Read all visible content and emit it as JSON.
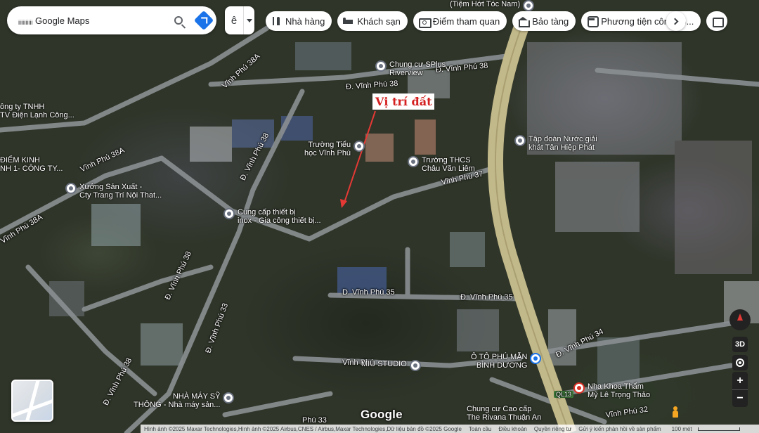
{
  "search": {
    "query": "ᵢᵢᵢᵢᵢᵢᵢᵢᵢᵢ Google Maps"
  },
  "hotel_toggle": {
    "glyph": "ê"
  },
  "chips": [
    {
      "label": "Nhà hàng",
      "icon": "fork-knife-icon"
    },
    {
      "label": "Khách sạn",
      "icon": "bed-icon"
    },
    {
      "label": "Điểm tham quan",
      "icon": "camera-icon"
    },
    {
      "label": "Bảo tàng",
      "icon": "museum-icon"
    },
    {
      "label": "Phương tiện công cộ...",
      "icon": "transit-icon"
    },
    {
      "label": "",
      "icon": "more-icon"
    }
  ],
  "annotation": {
    "text": "Vị trí đất",
    "color": "#d42020"
  },
  "roads": [
    {
      "label": "Đ. Vĩnh Phú 38"
    },
    {
      "label": "Đ. Vĩnh Phú 38"
    },
    {
      "label": "Vĩnh Phú 38A"
    },
    {
      "label": "Vĩnh Phú 38A"
    },
    {
      "label": "Vĩnh Phú 38A"
    },
    {
      "label": "Đ. Vĩnh Phú 38"
    },
    {
      "label": "Vĩnh Phú 37"
    },
    {
      "label": "Đ. Vĩnh Phú 38"
    },
    {
      "label": "D. Vĩnh Phú 35"
    },
    {
      "label": "Đ. Vĩnh Phú 35"
    },
    {
      "label": "Đ. Vĩnh Phú 33"
    },
    {
      "label": "Đ. Vĩnh Phú 38"
    },
    {
      "label": "Đ. Vĩnh Phú 34"
    },
    {
      "label": "Vĩnh Phú 32"
    },
    {
      "label": "Vĩnh Phú"
    },
    {
      "label": "Phú 33"
    },
    {
      "label": "QL13"
    }
  ],
  "pois": [
    {
      "name": "(Tiệm Hớt Tóc Nam)",
      "line2": "",
      "color": "gray"
    },
    {
      "name": "Chung cư SPlus",
      "line2": "Riverview",
      "color": "gray"
    },
    {
      "name": "ông ty TNHH",
      "line2": "TV Điện Lạnh Công...",
      "color": "gray"
    },
    {
      "name": "Trường Tiểu",
      "line2": "học Vĩnh Phú",
      "color": "gray"
    },
    {
      "name": "Trường THCS",
      "line2": "Châu Văn Liêm",
      "color": "gray"
    },
    {
      "name": "Tập đoàn Nước giải",
      "line2": "khát Tân Hiệp Phát",
      "color": "gray"
    },
    {
      "name": "ĐIỂM KINH",
      "line2": "NH 1- CÔNG TY...",
      "color": "gray"
    },
    {
      "name": "Xưởng Sản Xuất -",
      "line2": "Cty Trang Trí Nội That...",
      "color": "gray"
    },
    {
      "name": "Cung cấp thiết bị",
      "line2": "inox - Gia công thiết bị...",
      "color": "gray"
    },
    {
      "name": "Ô TÔ PHÚ MẪN",
      "line2": "BÌNH DƯƠNG",
      "color": "blue"
    },
    {
      "name": "MIU STUDIO",
      "line2": "",
      "color": "gray"
    },
    {
      "name": "Nha Khoa Thẩm",
      "line2": "Mỹ Lê Trọng Thảo",
      "color": "red"
    },
    {
      "name": "NHÀ MÁY SỸ",
      "line2": "THÔNG - Nhà máy sản...",
      "color": "gray"
    },
    {
      "name": "Chung cư Cao cấp",
      "line2": "The Rivana Thuận An",
      "color": "gray"
    }
  ],
  "controls": {
    "three_d": "3D",
    "zoom_in": "+",
    "zoom_out": "−"
  },
  "logo": "Google",
  "footer": {
    "attribution": "Hình ảnh ©2025 Maxar Technologies,Hình ảnh ©2025 Airbus,CNES / Airbus,Maxar Technologies,Dữ liệu bản đồ ©2025 Google",
    "links": [
      "Toàn cầu",
      "Điều khoản",
      "Quyền riêng tư",
      "Gửi ý kiến phản hồi về sản phẩm"
    ],
    "scale": "100 mét"
  }
}
